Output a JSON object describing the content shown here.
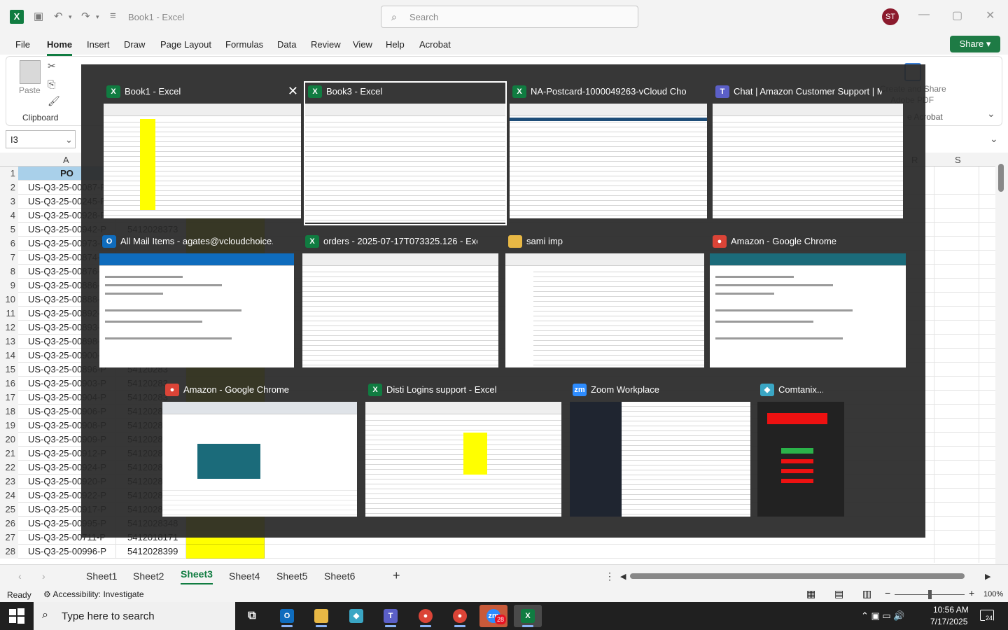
{
  "app": {
    "doc_title": "Book1 - Excel",
    "search_placeholder": "Search",
    "avatar_initials": "ST"
  },
  "menu": {
    "items": [
      "File",
      "Home",
      "Insert",
      "Draw",
      "Page Layout",
      "Formulas",
      "Data",
      "Review",
      "View",
      "Help",
      "Acrobat"
    ],
    "active": "Home",
    "share_label": "Share"
  },
  "ribbon": {
    "paste_label": "Paste",
    "clipboard_label": "Clipboard",
    "acrobat_line1": "Create and Share",
    "acrobat_line2": "Adobe PDF",
    "acrobat_group": "e Acrobat"
  },
  "namebox": {
    "value": "I3"
  },
  "grid": {
    "col_a_header": "A",
    "col_r_header": "R",
    "col_s_header": "S",
    "header_row": {
      "num": "1",
      "a": "PO"
    },
    "rows": [
      {
        "num": "2",
        "a": "US-Q3-25-00087-P",
        "b": ""
      },
      {
        "num": "3",
        "a": "US-Q3-25-00245-P",
        "b": ""
      },
      {
        "num": "4",
        "a": "US-Q3-25-00928-P",
        "b": ""
      },
      {
        "num": "5",
        "a": "US-Q3-25-00942-P",
        "b": "5412028373"
      },
      {
        "num": "6",
        "a": "US-Q3-25-00973-P",
        "b": ""
      },
      {
        "num": "7",
        "a": "US-Q3-25-00874-P",
        "b": ""
      },
      {
        "num": "8",
        "a": "US-Q3-25-00876-P",
        "b": ""
      },
      {
        "num": "9",
        "a": "US-Q3-25-00886-P",
        "b": ""
      },
      {
        "num": "10",
        "a": "US-Q3-25-00888-P",
        "b": ""
      },
      {
        "num": "11",
        "a": "US-Q3-25-00892-P",
        "b": ""
      },
      {
        "num": "12",
        "a": "US-Q3-25-00893-P",
        "b": ""
      },
      {
        "num": "13",
        "a": "US-Q3-25-00898-P",
        "b": ""
      },
      {
        "num": "14",
        "a": "US-Q3-25-00900-P",
        "b": ""
      },
      {
        "num": "15",
        "a": "US-Q3-25-00896-P",
        "b": "54120283"
      },
      {
        "num": "16",
        "a": "US-Q3-25-00903-P",
        "b": "54120283"
      },
      {
        "num": "17",
        "a": "US-Q3-25-00904-P",
        "b": "54120283"
      },
      {
        "num": "18",
        "a": "US-Q3-25-00906-P",
        "b": "54120283"
      },
      {
        "num": "19",
        "a": "US-Q3-25-00908-P",
        "b": "54120283"
      },
      {
        "num": "20",
        "a": "US-Q3-25-00909-P",
        "b": "54120283"
      },
      {
        "num": "21",
        "a": "US-Q3-25-00912-P",
        "b": "54120283"
      },
      {
        "num": "22",
        "a": "US-Q3-25-00924-P",
        "b": "54120283"
      },
      {
        "num": "23",
        "a": "US-Q3-25-00920-P",
        "b": "54120283"
      },
      {
        "num": "24",
        "a": "US-Q3-25-00922-P",
        "b": "54120283"
      },
      {
        "num": "25",
        "a": "US-Q3-25-00917-P",
        "b": "54120283"
      },
      {
        "num": "26",
        "a": "US-Q3-25-00995-P",
        "b": "5412028348"
      },
      {
        "num": "27",
        "a": "US-Q3-25-00711-P",
        "b": "5412018171"
      },
      {
        "num": "28",
        "a": "US-Q3-25-00996-P",
        "b": "5412028399"
      }
    ]
  },
  "sheets": {
    "tabs": [
      "Sheet1",
      "Sheet2",
      "Sheet3",
      "Sheet4",
      "Sheet5",
      "Sheet6"
    ],
    "active": "Sheet3",
    "add_label": "+"
  },
  "status": {
    "ready": "Ready",
    "accessibility": "Accessibility: Investigate",
    "zoom": "100%"
  },
  "switcher": {
    "windows": [
      {
        "title": "Book1 - Excel",
        "icon": "excel-icon",
        "color": "#107c41",
        "glyph": "X",
        "close": "✕"
      },
      {
        "title": "Book3 - Excel",
        "icon": "excel-icon",
        "color": "#107c41",
        "glyph": "X"
      },
      {
        "title": "NA-Postcard-1000049263-vCloud Choic...",
        "icon": "excel-icon",
        "color": "#107c41",
        "glyph": "X"
      },
      {
        "title": "Chat | Amazon Customer Support | Mi...",
        "icon": "teams-icon",
        "color": "#5b5fc7",
        "glyph": "T"
      },
      {
        "title": "All Mail Items - agates@vcloudchoice.c...",
        "icon": "outlook-icon",
        "color": "#0f6cbd",
        "glyph": "O"
      },
      {
        "title": "orders - 2025-07-17T073325.126 - Excel",
        "icon": "excel-icon",
        "color": "#107c41",
        "glyph": "X"
      },
      {
        "title": "sami imp",
        "icon": "folder-icon",
        "color": "#e8b845",
        "glyph": ""
      },
      {
        "title": "Amazon - Google Chrome",
        "icon": "chrome-icon",
        "color": "#db4437",
        "glyph": "●"
      },
      {
        "title": "Amazon - Google Chrome",
        "icon": "chrome-icon",
        "color": "#db4437",
        "glyph": "●"
      },
      {
        "title": "Disti Logins support - Excel",
        "icon": "excel-icon",
        "color": "#107c41",
        "glyph": "X"
      },
      {
        "title": "Zoom Workplace",
        "icon": "zoom-icon",
        "color": "#2d8cff",
        "glyph": "zm"
      },
      {
        "title": "Comtanix...",
        "icon": "comtanix-icon",
        "color": "#3aa6c4",
        "glyph": "◆"
      }
    ]
  },
  "taskbar": {
    "search_placeholder": "Type here to search",
    "zoom_badge": "28",
    "time": "10:56 AM",
    "date": "7/17/2025",
    "notif_count": "24"
  }
}
